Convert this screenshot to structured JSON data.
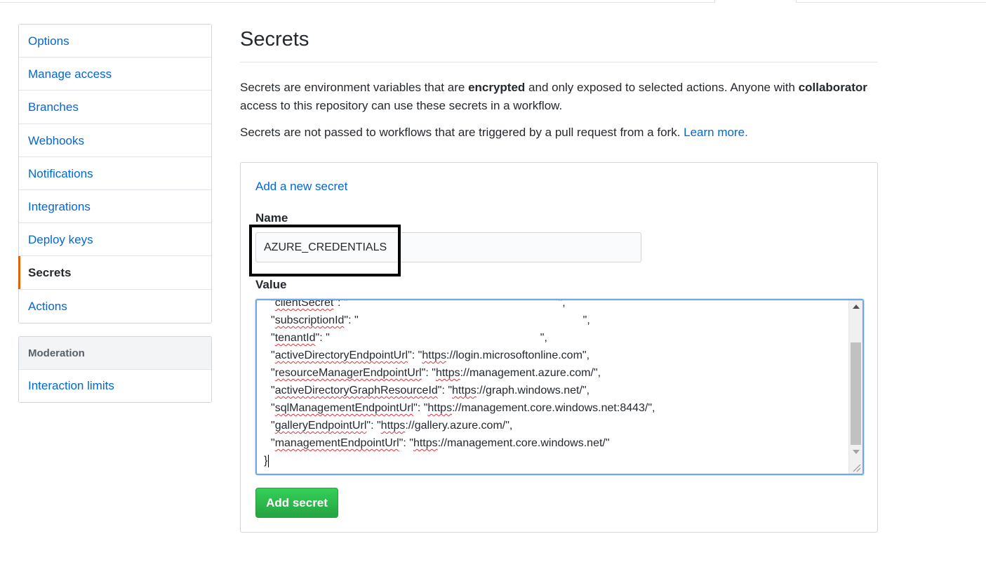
{
  "sidebar": {
    "items": [
      {
        "label": "Options"
      },
      {
        "label": "Manage access"
      },
      {
        "label": "Branches"
      },
      {
        "label": "Webhooks"
      },
      {
        "label": "Notifications"
      },
      {
        "label": "Integrations"
      },
      {
        "label": "Deploy keys"
      },
      {
        "label": "Secrets",
        "selected": true
      },
      {
        "label": "Actions"
      }
    ],
    "moderation_heading": "Moderation",
    "moderation_items": [
      {
        "label": "Interaction limits"
      }
    ]
  },
  "main": {
    "title": "Secrets",
    "description_part1": "Secrets are environment variables that are ",
    "description_bold1": "encrypted",
    "description_part2": " and only exposed to selected actions. Anyone with ",
    "description_bold2": "collaborator",
    "description_part3": " access to this repository can use these secrets in a workflow.",
    "fork_notice": "Secrets are not passed to workflows that are triggered by a pull request from a fork. ",
    "learn_more": "Learn more."
  },
  "form": {
    "heading": "Add a new secret",
    "name_label": "Name",
    "name_value": "AZURE_CREDENTIALS",
    "value_label": "Value",
    "value_lines": [
      {
        "key": "clientSecret",
        "sep": "\": \"",
        "val": "",
        "tail": "\","
      },
      {
        "key": "subscriptionId",
        "sep": "\": \"",
        "val": "",
        "tail": "\","
      },
      {
        "key": "tenantId",
        "sep": "\": \"",
        "val": "",
        "tail": "\","
      },
      {
        "key": "activeDirectoryEndpointUrl",
        "sep": "\": \"",
        "val": "https://login.microsoftonline.com",
        "tail": "\","
      },
      {
        "key": "resourceManagerEndpointUrl",
        "sep": "\": \"",
        "val": "https://management.azure.com/",
        "tail": "\","
      },
      {
        "key": "activeDirectoryGraphResourceId",
        "sep": "\": \"",
        "val": "https://graph.windows.net/",
        "tail": "\","
      },
      {
        "key": "sqlManagementEndpointUrl",
        "sep": "\": \"",
        "val": "https://management.core.windows.net:8443/",
        "tail": "\","
      },
      {
        "key": "galleryEndpointUrl",
        "sep": "\": \"",
        "val": "https://gallery.azure.com/",
        "tail": "\","
      },
      {
        "key": "managementEndpointUrl",
        "sep": "\": \"",
        "val": "https://management.core.windows.net/",
        "tail": "\""
      }
    ],
    "closing_brace": "}",
    "submit_label": "Add secret"
  },
  "colors": {
    "link": "#0366d6",
    "selected_accent": "#e36209",
    "button_green": "#28a745",
    "focus_border": "#6fa8e8"
  }
}
